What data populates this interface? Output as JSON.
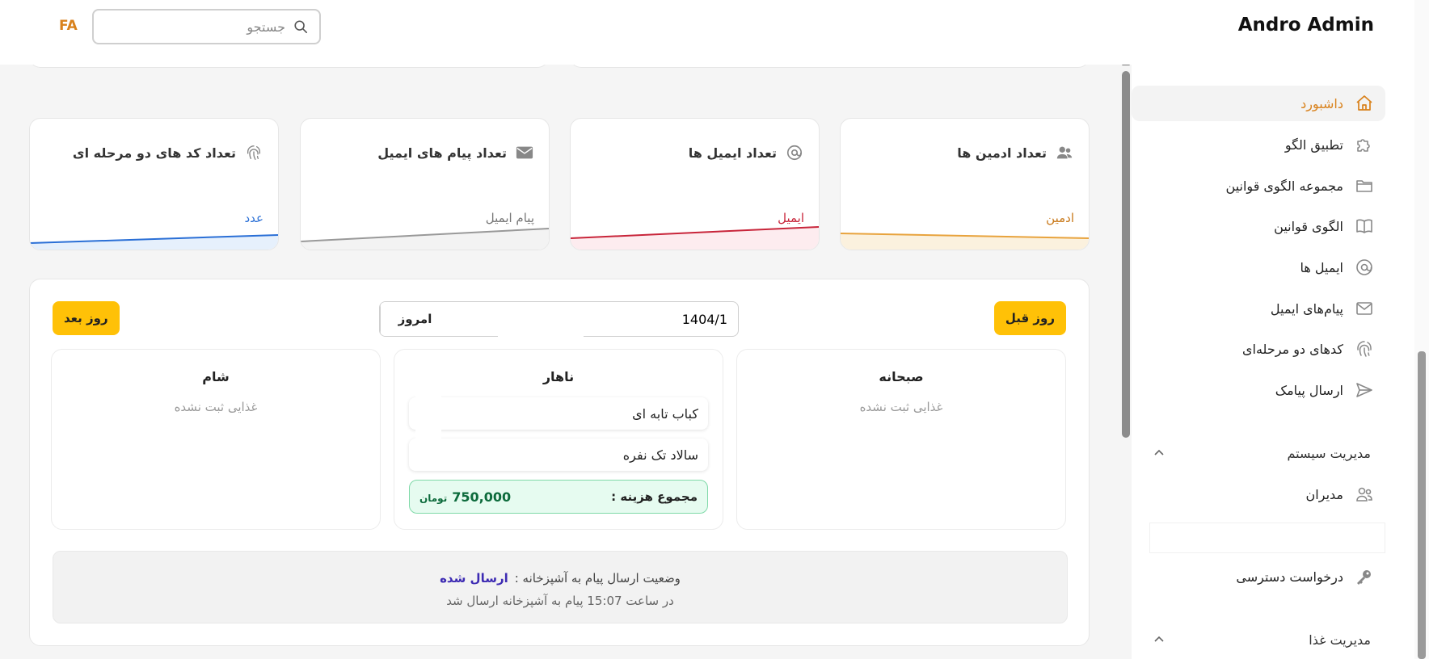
{
  "header": {
    "brand": "Andro Admin",
    "lang": "FA",
    "search_placeholder": "جستجو"
  },
  "sidebar": {
    "items": [
      {
        "label": "داشبورد",
        "icon": "home-icon",
        "active": true
      },
      {
        "label": "تطبیق الگو",
        "icon": "puzzle-icon"
      },
      {
        "label": "مجموعه الگوی قوانین",
        "icon": "folder-icon"
      },
      {
        "label": "الگوی قوانین",
        "icon": "book-icon"
      },
      {
        "label": "ایمیل ها",
        "icon": "at-icon"
      },
      {
        "label": "پیام‌های ایمیل",
        "icon": "envelope-icon"
      },
      {
        "label": "کدهای دو مرحله‌ای",
        "icon": "fingerprint-icon"
      },
      {
        "label": "ارسال پیامک",
        "icon": "send-icon"
      }
    ],
    "section_system": "مدیریت سیستم",
    "managers": "مدیران",
    "access_request": "درخواست دسترسی",
    "section_food": "مدیریت غذا"
  },
  "stats": [
    {
      "title": "تعداد ادمین ها",
      "unit": "ادمین",
      "color": "#e8a33d",
      "icon": "users-icon"
    },
    {
      "title": "تعداد ایمیل ها",
      "unit": "ایمیل",
      "color": "#c8253a",
      "icon": "at-icon"
    },
    {
      "title": "تعداد پیام های ایمیل",
      "unit": "پیام ایمیل",
      "color": "#999999",
      "icon": "envelope-icon"
    },
    {
      "title": "تعداد کد های دو مرحله ای",
      "unit": "عدد",
      "color": "#2a6fd6",
      "icon": "fingerprint-icon"
    }
  ],
  "meals": {
    "prev_day": "روز قبل",
    "next_day": "روز بعد",
    "today": "امروز",
    "date_value": "1404/1",
    "breakfast": {
      "title": "صبحانه",
      "empty": "غذایی ثبت نشده"
    },
    "lunch": {
      "title": "ناهار",
      "items": [
        "کباب تابه ای",
        "سالاد تک نفره"
      ],
      "total_label": "مجموع هزینه :",
      "total_value": "750,000",
      "currency": "تومان"
    },
    "dinner": {
      "title": "شام",
      "empty": "غذایی ثبت نشده"
    }
  },
  "kitchen": {
    "status_label": "وضعیت ارسال پیام به آشپزخانه :",
    "status_value": "ارسال شده",
    "sent_message": "در ساعت 15:07 پیام به آشپزخانه ارسال شد"
  }
}
